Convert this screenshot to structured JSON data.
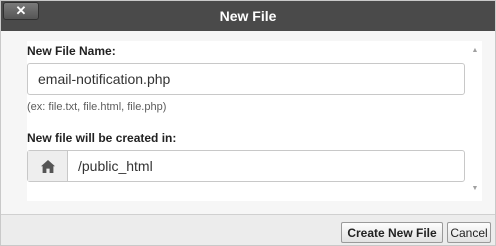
{
  "dialog": {
    "title": "New File",
    "close_label": "✕"
  },
  "form": {
    "file_name_label": "New File Name:",
    "file_name_value": "email-notification.php",
    "file_name_hint": "(ex: file.txt, file.html, file.php)",
    "location_label": "New file will be created in:",
    "location_icon": "home-icon",
    "location_value": "/public_html"
  },
  "footer": {
    "create_label": "Create New File",
    "cancel_label": "Cancel"
  }
}
